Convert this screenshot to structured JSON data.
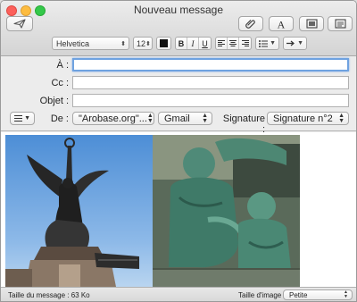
{
  "window": {
    "title": "Nouveau message"
  },
  "toolbar": {
    "send_icon": "paper-plane-icon",
    "attach_icon": "paperclip-icon",
    "fonts_icon": "font-a-icon",
    "photo_icon": "photo-browser-icon",
    "template_icon": "stationery-icon"
  },
  "format": {
    "font_family": "Helvetica",
    "font_size": "12",
    "color": "#111111",
    "bold": "B",
    "italic": "I",
    "underline": "U"
  },
  "headers": {
    "to_label": "À :",
    "to_value": "",
    "cc_label": "Cc :",
    "cc_value": "",
    "subject_label": "Objet :",
    "subject_value": "",
    "from_label": "De :",
    "from_value": "\"Arobase.org\"...",
    "account_value": "Gmail",
    "signature_label": "Signature :",
    "signature_value": "Signature n°2"
  },
  "status": {
    "size_text": "Taille du message : 63 Ko",
    "image_size_label": "Taille d'image :",
    "image_size_value": "Petite"
  }
}
